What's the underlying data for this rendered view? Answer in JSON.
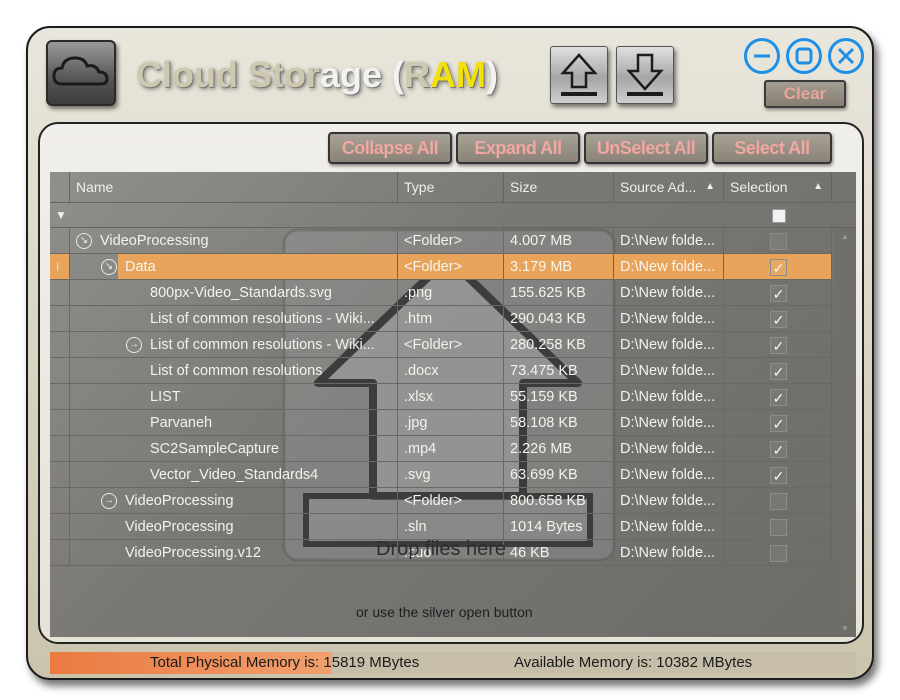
{
  "app": {
    "title_part1": "Cloud Stor",
    "title_part2": "age",
    "title_part3": " (",
    "title_r": "R",
    "title_am": "AM",
    "title_close": ")",
    "clear_label": "Clear",
    "logo_icon": "cloud-icon",
    "upload_icon": "upload-arrow-icon",
    "download_icon": "download-arrow-icon"
  },
  "toolbar": {
    "collapse_all": "Collapse All",
    "expand_all": "Expand All",
    "unselect_all": "UnSelect All",
    "select_all": "Select All"
  },
  "grid": {
    "columns": [
      "Name",
      "Type",
      "Size",
      "Source Ad...",
      "Selection"
    ],
    "overlay_drop_text": "Drop files here",
    "overlay_hint": "or use the silver open button",
    "rows": [
      {
        "name": "VideoProcessing",
        "type": "<Folder>",
        "size": "4.007 MB",
        "source": "D:\\New folde...",
        "checked": false,
        "expander": "collapse"
      },
      {
        "name": "Data",
        "type": "<Folder>",
        "size": "3.179 MB",
        "source": "D:\\New folde...",
        "checked": true,
        "expander": "collapse"
      },
      {
        "name": "800px-Video_Standards.svg",
        "type": ".png",
        "size": "155.625 KB",
        "source": "D:\\New folde...",
        "checked": true
      },
      {
        "name": "List of common resolutions - Wiki...",
        "type": ".htm",
        "size": "290.043 KB",
        "source": "D:\\New folde...",
        "checked": true
      },
      {
        "name": "List of common resolutions - Wiki...",
        "type": "<Folder>",
        "size": "280.258 KB",
        "source": "D:\\New folde...",
        "checked": true,
        "expander": "expand"
      },
      {
        "name": "List of common resolutions",
        "type": ".docx",
        "size": "73.475 KB",
        "source": "D:\\New folde...",
        "checked": true
      },
      {
        "name": "LIST",
        "type": ".xlsx",
        "size": "55.159 KB",
        "source": "D:\\New folde...",
        "checked": true
      },
      {
        "name": "Parvaneh",
        "type": ".jpg",
        "size": "58.108 KB",
        "source": "D:\\New folde...",
        "checked": true
      },
      {
        "name": "SC2SampleCapture",
        "type": ".mp4",
        "size": "2.226 MB",
        "source": "D:\\New folde...",
        "checked": true
      },
      {
        "name": "Vector_Video_Standards4",
        "type": ".svg",
        "size": "63.699 KB",
        "source": "D:\\New folde...",
        "checked": true
      },
      {
        "name": "VideoProcessing",
        "type": "<Folder>",
        "size": "800.658 KB",
        "source": "D:\\New folde...",
        "checked": false,
        "expander": "expand"
      },
      {
        "name": "VideoProcessing",
        "type": ".sln",
        "size": "1014 Bytes",
        "source": "D:\\New folde...",
        "checked": false
      },
      {
        "name": "VideoProcessing.v12",
        "type": ".suo",
        "size": "46 KB",
        "source": "D:\\New folde...",
        "checked": false
      }
    ]
  },
  "status": {
    "total_memory": "Total Physical Memory is: 15819 MBytes",
    "available_memory": "Available Memory is: 10382 MBytes",
    "memory_used_fraction": 0.35
  },
  "colors": {
    "selected_row": "#e7a45a",
    "title_accent": "#f3e10b",
    "window_controls": "#1d8fe6"
  }
}
